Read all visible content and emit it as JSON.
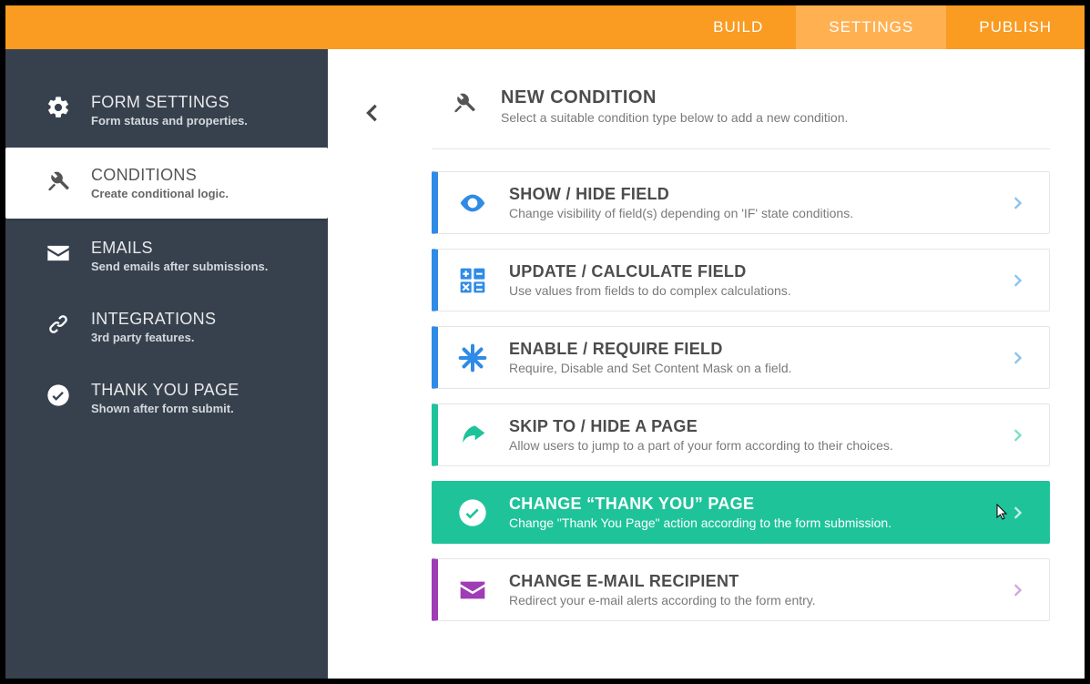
{
  "topnav": {
    "items": [
      {
        "label": "BUILD",
        "active": false
      },
      {
        "label": "SETTINGS",
        "active": true
      },
      {
        "label": "PUBLISH",
        "active": false
      }
    ]
  },
  "sidebar": {
    "items": [
      {
        "icon": "gear-icon",
        "title": "FORM SETTINGS",
        "sub": "Form status and properties.",
        "active": false
      },
      {
        "icon": "tools-icon",
        "title": "CONDITIONS",
        "sub": "Create conditional logic.",
        "active": true
      },
      {
        "icon": "mail-icon",
        "title": "EMAILS",
        "sub": "Send emails after submissions.",
        "active": false
      },
      {
        "icon": "link-icon",
        "title": "INTEGRATIONS",
        "sub": "3rd party features.",
        "active": false
      },
      {
        "icon": "check-icon",
        "title": "THANK YOU PAGE",
        "sub": "Shown after form submit.",
        "active": false
      }
    ]
  },
  "header": {
    "title": "NEW CONDITION",
    "sub": "Select a suitable condition type below to add a new condition."
  },
  "colors": {
    "blue": "#2e8be6",
    "green": "#1fc39a",
    "purple": "#9e3db5",
    "chev_blue": "#89c3ef",
    "chev_green": "#7adfc6",
    "chev_purple": "#d0a6de"
  },
  "conditions": [
    {
      "icon": "eye-icon",
      "stripe": "blue",
      "chev": "chev_blue",
      "title": "SHOW / HIDE FIELD",
      "sub": "Change visibility of field(s) depending on 'IF' state conditions.",
      "selected": false
    },
    {
      "icon": "calc-icon",
      "stripe": "blue",
      "chev": "chev_blue",
      "title": "UPDATE / CALCULATE FIELD",
      "sub": "Use values from fields to do complex calculations.",
      "selected": false
    },
    {
      "icon": "star-icon",
      "stripe": "blue",
      "chev": "chev_blue",
      "title": "ENABLE / REQUIRE FIELD",
      "sub": "Require, Disable and Set Content Mask on a field.",
      "selected": false
    },
    {
      "icon": "share-icon",
      "stripe": "green",
      "chev": "chev_green",
      "title": "SKIP TO / HIDE A PAGE",
      "sub": "Allow users to jump to a part of your form according to their choices.",
      "selected": false
    },
    {
      "icon": "check-icon",
      "stripe": "green",
      "chev": "chev_green",
      "title": "CHANGE “THANK YOU” PAGE",
      "sub": "Change \"Thank You Page\" action according to the form submission.",
      "selected": true
    },
    {
      "icon": "mail-icon",
      "stripe": "purple",
      "chev": "chev_purple",
      "title": "CHANGE E-MAIL RECIPIENT",
      "sub": "Redirect your e-mail alerts according to the form entry.",
      "selected": false
    }
  ]
}
